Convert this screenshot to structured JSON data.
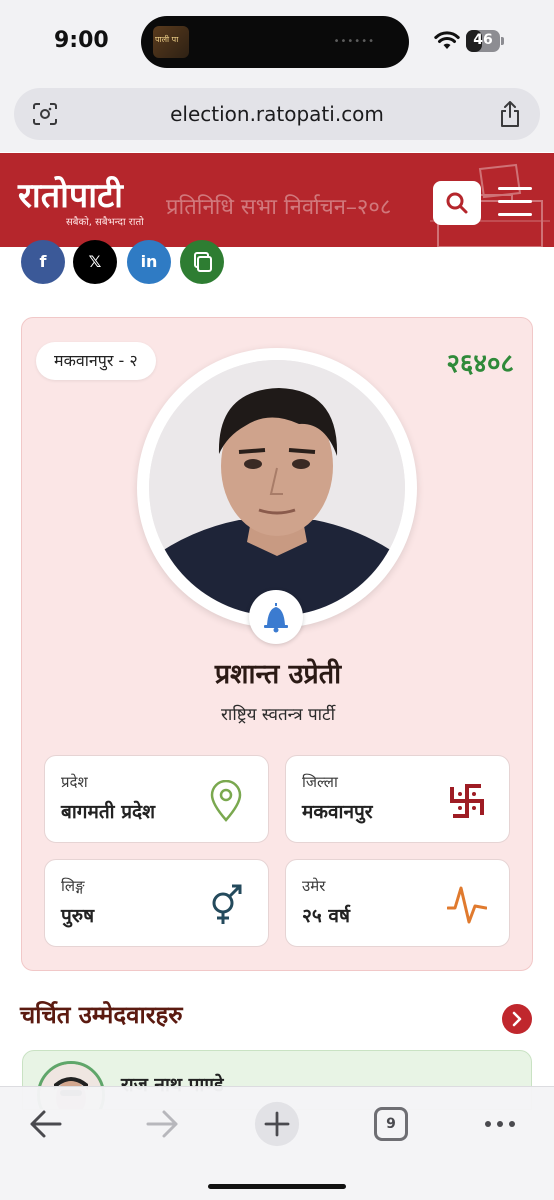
{
  "status_bar": {
    "time": "9:00",
    "battery_level": "46",
    "island_thumb_text": "पाली पा"
  },
  "browser": {
    "url": "election.ratopati.com"
  },
  "site_header": {
    "logo": "रातोपाटी",
    "tagline": "सबैको, सबैभन्दा रातो",
    "title": "प्रतिनिधि सभा निर्वाचन–२०८"
  },
  "share": {
    "facebook": "f",
    "x": "𝕏",
    "linkedin": "in"
  },
  "candidate": {
    "constituency": "मकवानपुर - २",
    "votes": "२६४०८",
    "name": "प्रशान्त उप्रेती",
    "party": "राष्ट्रिय स्वतन्त्र पार्टी",
    "info": [
      {
        "label": "प्रदेश",
        "value": "बागमती प्रदेश",
        "icon": "location-pin-icon"
      },
      {
        "label": "जिल्ला",
        "value": "मकवानपुर",
        "icon": "swastika-icon"
      },
      {
        "label": "लिङ्ग",
        "value": "पुरुष",
        "icon": "gender-icon"
      },
      {
        "label": "उमेर",
        "value": "२५ वर्ष",
        "icon": "pulse-icon"
      }
    ]
  },
  "section": {
    "title": "चर्चित उम्मेदवारहरु",
    "featured_name": "राज नाथ पाण्डे"
  },
  "toolbar": {
    "tab_count": "9"
  },
  "colors": {
    "brand_red": "#b5262c",
    "card_bg": "#fbe6e6",
    "vote_green": "#2f8a3a"
  }
}
